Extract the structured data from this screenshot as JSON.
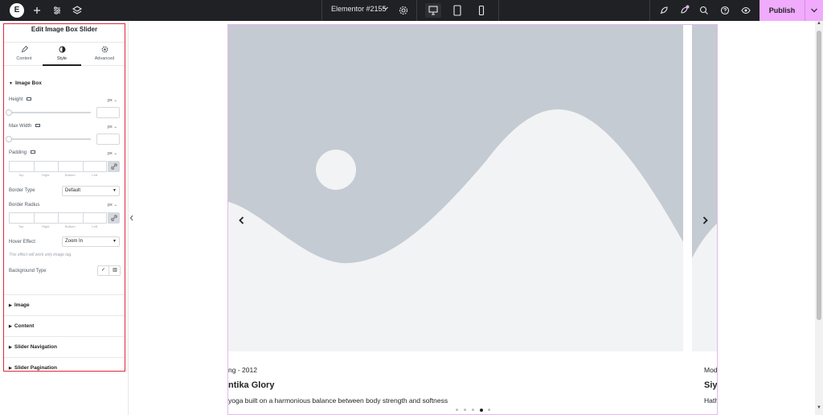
{
  "topbar": {
    "logo_text": "E",
    "document_title": "Elementor #2155",
    "publish_label": "Publish",
    "icons": [
      "elementor-logo-icon",
      "add-icon",
      "settings-sliders-icon",
      "layers-icon",
      "gear-icon",
      "desktop-icon",
      "tablet-icon",
      "mobile-icon",
      "rocket-icon",
      "notification-icon",
      "search-icon",
      "help-icon",
      "eye-icon",
      "chevron-down-icon"
    ],
    "accent_color": "#f0abfc"
  },
  "panel": {
    "title": "Edit Image Box Slider",
    "tabs": [
      {
        "label": "Content",
        "icon": "pencil-icon"
      },
      {
        "label": "Style",
        "icon": "half-circle-icon"
      },
      {
        "label": "Advanced",
        "icon": "gear-icon"
      }
    ],
    "active_tab": "Style",
    "section_image_box": "Image Box",
    "height_label": "Height",
    "height_unit": "px",
    "max_width_label": "Max Width",
    "max_width_unit": "px",
    "padding_label": "Padding",
    "padding_unit": "px",
    "dim_labels": [
      "Top",
      "Right",
      "Bottom",
      "Left"
    ],
    "border_type_label": "Border Type",
    "border_type_value": "Default",
    "border_radius_label": "Border Radius",
    "border_radius_unit": "px",
    "hover_effect_label": "Hover Effect",
    "hover_effect_value": "Zoom In",
    "hover_note": "This effect will work only image tag.",
    "background_type_label": "Background Type",
    "sections": [
      "Image",
      "Content",
      "Slider Navigation",
      "Slider Pagination"
    ]
  },
  "canvas": {
    "slide1": {
      "meta": "ng - 2012",
      "name": "ntika Glory",
      "desc": "yoga built on a harmonious balance between body strength and softness"
    },
    "slide2": {
      "meta": "Mod",
      "name": "Siy",
      "desc": "Hath"
    },
    "pagination_count": 5,
    "active_dot": 4
  }
}
